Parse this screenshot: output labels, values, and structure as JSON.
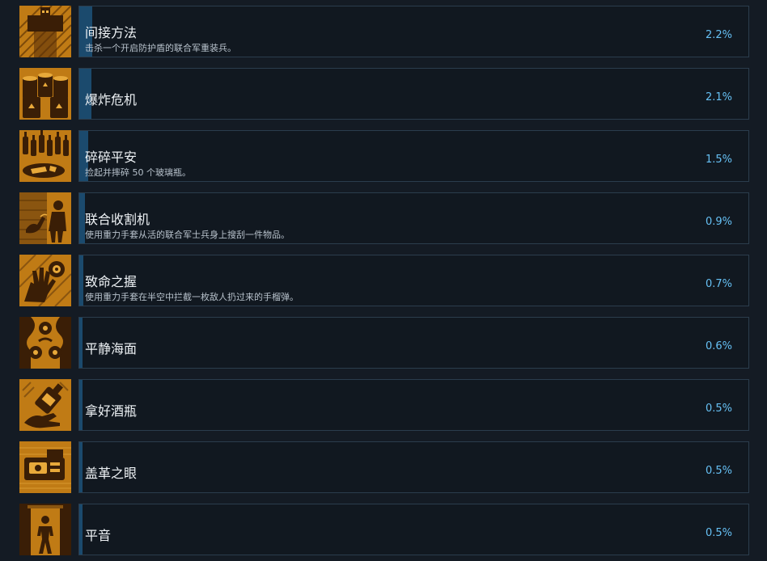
{
  "achievements": [
    {
      "title": "间接方法",
      "description": "击杀一个开启防护盾的联合军重装兵。",
      "percent_label": "2.2%",
      "percent": 2.2,
      "icon": "shielded-soldier-icon"
    },
    {
      "title": "爆炸危机",
      "description": "",
      "percent_label": "2.1%",
      "percent": 2.1,
      "icon": "explosive-barrels-icon"
    },
    {
      "title": "碎碎平安",
      "description": "捡起并摔碎 50 个玻璃瓶。",
      "percent_label": "1.5%",
      "percent": 1.5,
      "icon": "broken-bottles-icon"
    },
    {
      "title": "联合收割机",
      "description": "使用重力手套从活的联合军士兵身上搜刮一件物品。",
      "percent_label": "0.9%",
      "percent": 0.9,
      "icon": "gravity-glove-grab-icon"
    },
    {
      "title": "致命之握",
      "description": "使用重力手套在半空中拦截一枚敌人扔过来的手榴弹。",
      "percent_label": "0.7%",
      "percent": 0.7,
      "icon": "grenade-catch-icon"
    },
    {
      "title": "平静海面",
      "description": "",
      "percent_label": "0.6%",
      "percent": 0.6,
      "icon": "calm-faces-icon"
    },
    {
      "title": "拿好酒瓶",
      "description": "",
      "percent_label": "0.5%",
      "percent": 0.5,
      "icon": "hold-bottle-icon"
    },
    {
      "title": "盖革之眼",
      "description": "",
      "percent_label": "0.5%",
      "percent": 0.5,
      "icon": "geiger-counter-icon"
    },
    {
      "title": "平音",
      "description": "",
      "percent_label": "0.5%",
      "percent": 0.5,
      "icon": "doorway-figure-icon"
    }
  ],
  "colors": {
    "accent": "#66c0f4",
    "progress_bar": "#1b4a6d",
    "icon_orange": "#c07b15",
    "icon_dark": "#3a1e06",
    "panel_border": "#2b3d4d",
    "background": "#141b24"
  }
}
